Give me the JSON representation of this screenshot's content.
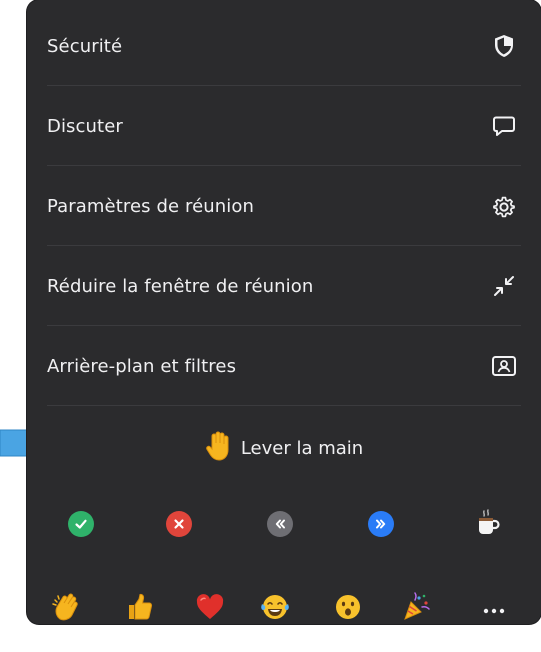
{
  "menu": {
    "items": [
      {
        "label": "Sécurité",
        "icon": "shield-icon"
      },
      {
        "label": "Discuter",
        "icon": "chat-icon"
      },
      {
        "label": "Paramètres de réunion",
        "icon": "gear-icon"
      },
      {
        "label": "Réduire la fenêtre de réunion",
        "icon": "minimize-icon"
      },
      {
        "label": "Arrière-plan et filtres",
        "icon": "portrait-icon"
      }
    ]
  },
  "raise_hand": {
    "label": "Lever la main",
    "icon": "raised-hand-icon"
  },
  "feedback": [
    {
      "icon": "yes-icon",
      "color": "#2fb26a"
    },
    {
      "icon": "no-icon",
      "color": "#e0453b"
    },
    {
      "icon": "slower-icon",
      "color": "#6e6e73"
    },
    {
      "icon": "faster-icon",
      "color": "#2a7cf7"
    },
    {
      "icon": "coffee-cup-icon",
      "color": "#f0f0f0"
    }
  ],
  "reactions": [
    {
      "icon": "clapping-hands-icon"
    },
    {
      "icon": "thumbs-up-icon"
    },
    {
      "icon": "heart-icon"
    },
    {
      "icon": "tears-of-joy-icon"
    },
    {
      "icon": "surprised-face-icon"
    },
    {
      "icon": "party-popper-icon"
    },
    {
      "icon": "more-icon"
    }
  ],
  "colors": {
    "panel": "#2b2b2d",
    "text": "#f0f0f2",
    "arrow": "#4aa4e3"
  }
}
